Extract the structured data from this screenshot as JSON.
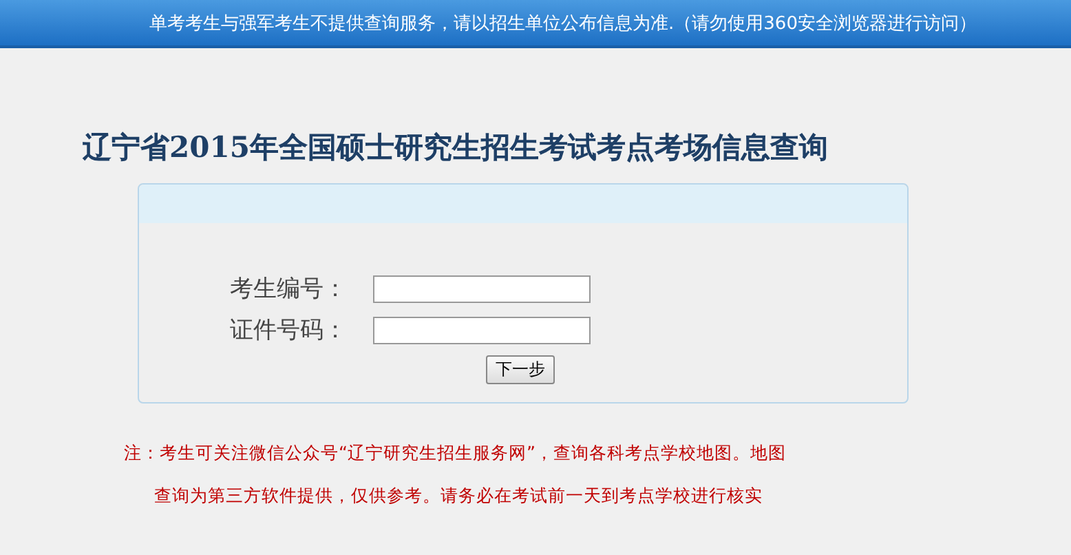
{
  "notice_bar": {
    "text": "单考考生与强军考生不提供查询服务，请以招生单位公布信息为准.（请勿使用360安全浏览器进行访问）"
  },
  "title": "辽宁省2015年全国硕士研究生招生考试考点考场信息查询",
  "form": {
    "fields": [
      {
        "label": "考生编号："
      },
      {
        "label": "证件号码："
      }
    ],
    "button": "下一步"
  },
  "note_lines": [
    "注：考生可关注微信公众号“辽宁研究生招生服务网”，查询各科考点学校地图。地图",
    "查询为第三方软件提供，仅供参考。请务必在考试前一天到考点学校进行核实"
  ]
}
